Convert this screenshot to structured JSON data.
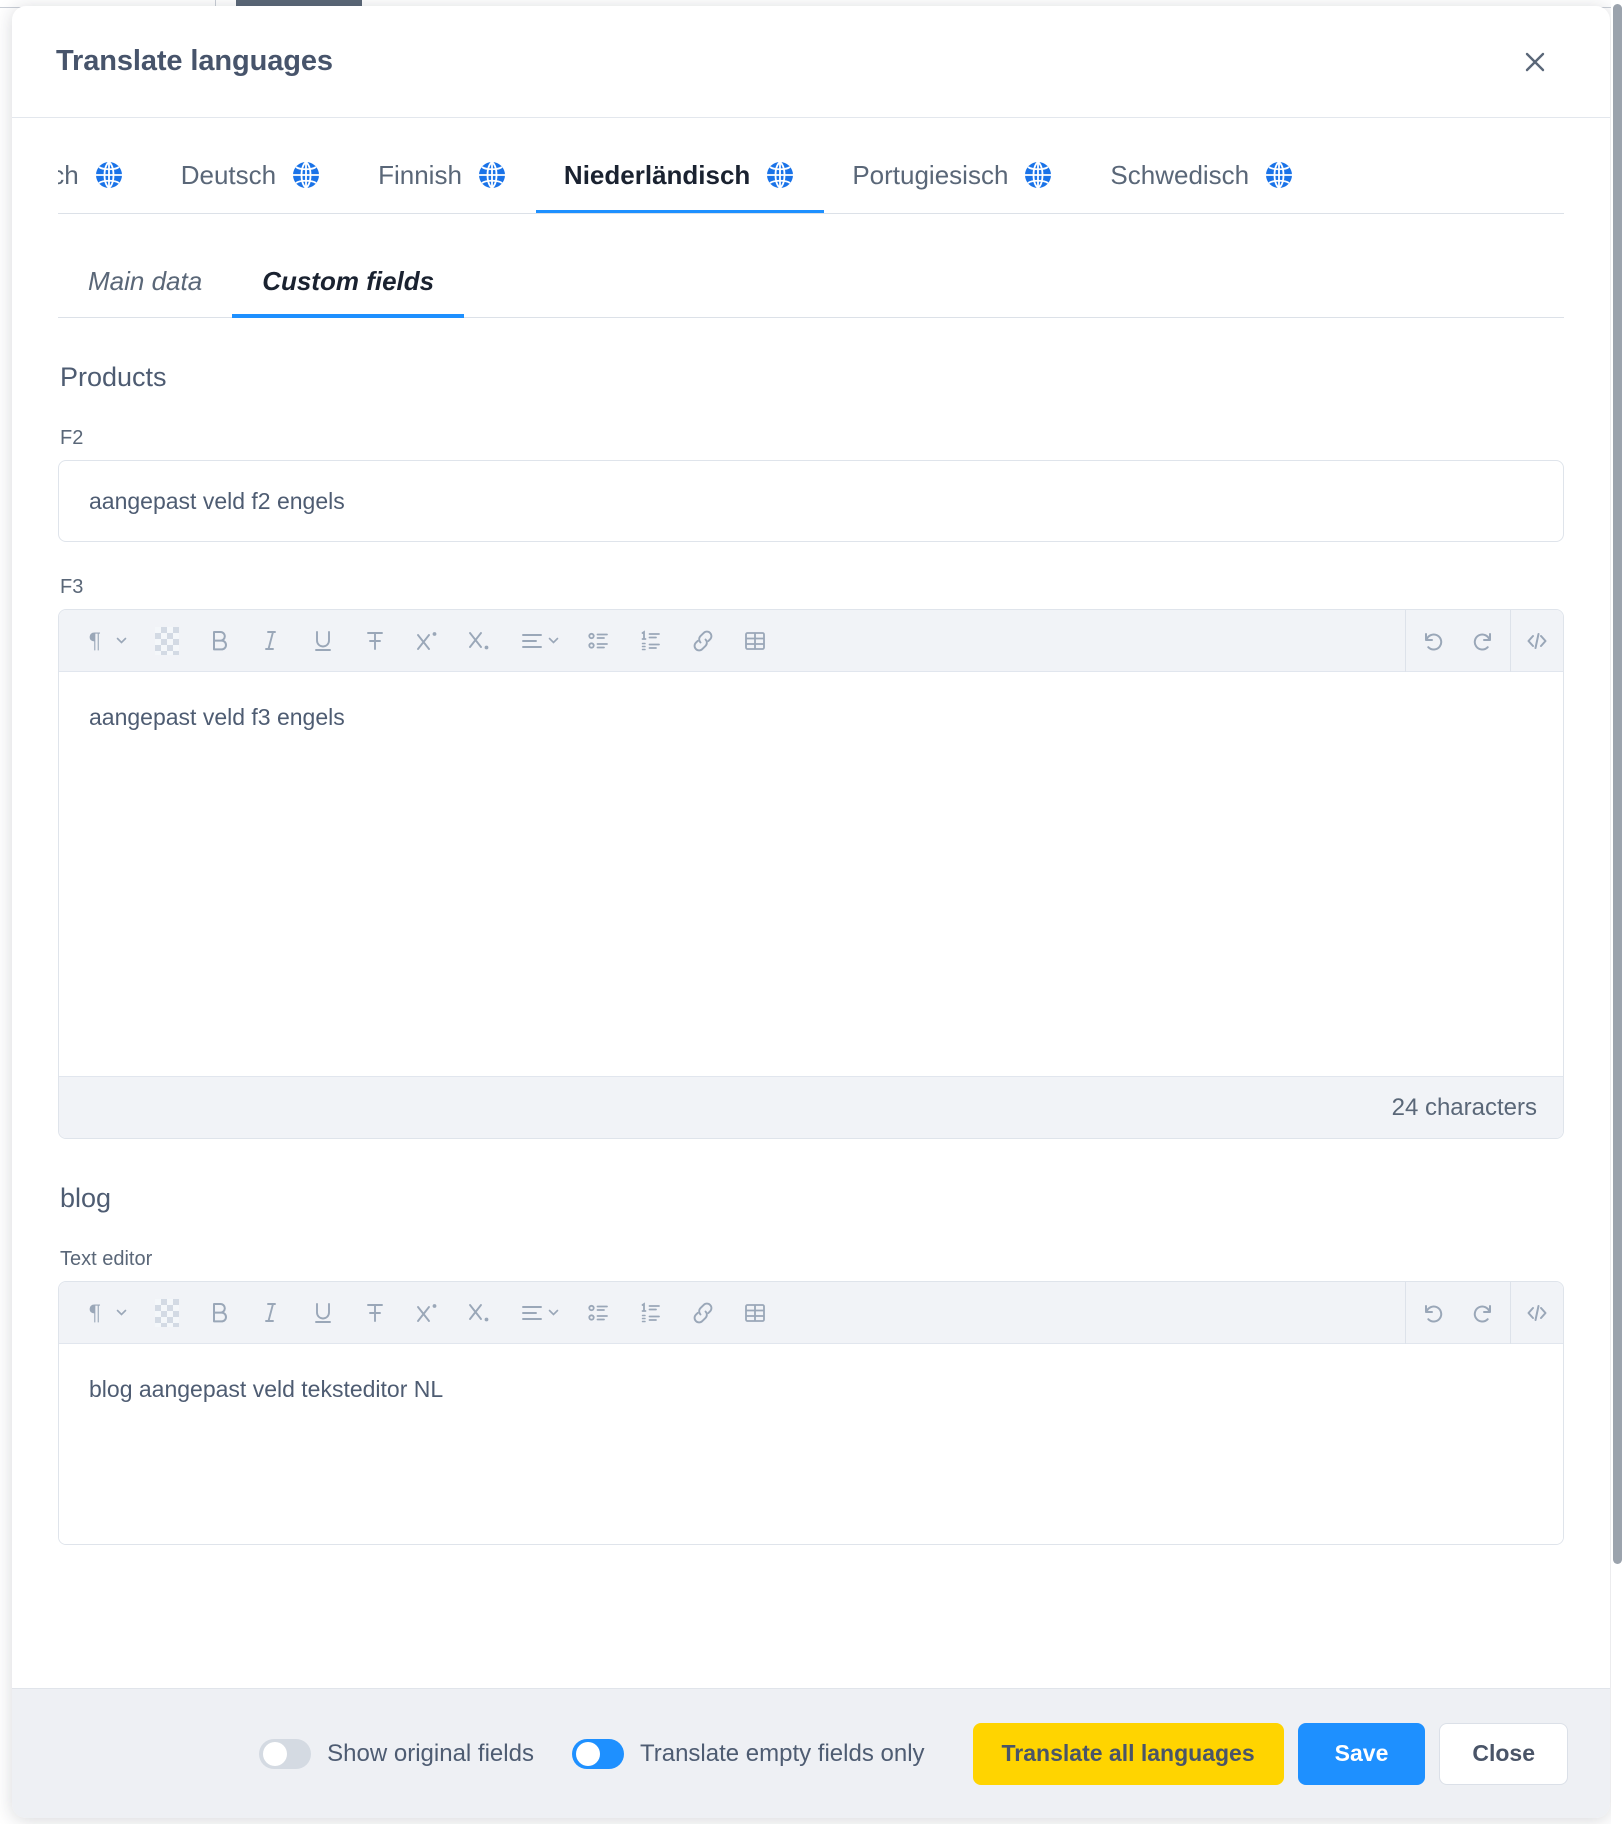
{
  "header": {
    "title": "Translate languages",
    "close_icon": "close-icon"
  },
  "language_tabs": [
    {
      "label": "nisch",
      "icon": "globe-icon",
      "active": false,
      "clipped": true
    },
    {
      "label": "Deutsch",
      "icon": "globe-icon",
      "active": false
    },
    {
      "label": "Finnish",
      "icon": "globe-icon",
      "active": false
    },
    {
      "label": "Niederländisch",
      "icon": "globe-icon",
      "active": true
    },
    {
      "label": "Portugiesisch",
      "icon": "globe-icon",
      "active": false
    },
    {
      "label": "Schwedisch",
      "icon": "globe-icon",
      "active": false
    }
  ],
  "sub_tabs": [
    {
      "label": "Main data",
      "active": false
    },
    {
      "label": "Custom fields",
      "active": true
    }
  ],
  "sections": [
    {
      "title": "Products",
      "fields": [
        {
          "type": "text",
          "label": "F2",
          "value": "aangepast veld f2 engels",
          "placeholder": ""
        },
        {
          "type": "richtext",
          "label": "F3",
          "value": "aangepast veld f3 engels",
          "counter": "24 characters"
        }
      ]
    },
    {
      "title": "blog",
      "fields": [
        {
          "type": "richtext",
          "label": "Text editor",
          "value": "blog aangepast veld teksteditor NL",
          "counter": ""
        }
      ]
    }
  ],
  "toolbar_icons": [
    "paragraph-format-icon",
    "chevron-down-icon",
    "text-color-icon",
    "bold-icon",
    "italic-icon",
    "underline-icon",
    "strikethrough-icon",
    "superscript-icon",
    "subscript-icon",
    "align-icon",
    "chevron-down-icon",
    "bullet-list-icon",
    "numbered-list-icon",
    "link-icon",
    "table-icon",
    "undo-icon",
    "redo-icon",
    "source-code-icon"
  ],
  "footer": {
    "toggles": [
      {
        "label": "Show original fields",
        "on": false
      },
      {
        "label": "Translate empty fields only",
        "on": true
      }
    ],
    "buttons": [
      {
        "label": "Translate all languages",
        "style": "translate"
      },
      {
        "label": "Save",
        "style": "save"
      },
      {
        "label": "Close",
        "style": "close"
      }
    ]
  },
  "colors": {
    "accent_blue": "#1e90ff",
    "yellow": "#ffd400",
    "text_dark": "#4e5c72",
    "footer_bg": "#eef0f4",
    "toolbar_bg": "#f1f3f7"
  }
}
